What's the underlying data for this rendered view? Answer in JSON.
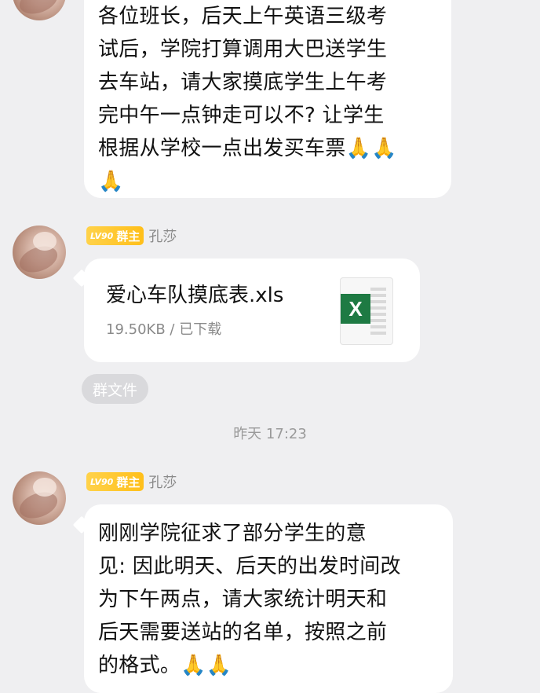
{
  "messages": [
    {
      "text": "各位班长，后天上午英语三级考\n试后，学院打算调用大巴送学生\n去车站，请大家摸底学生上午考\n完中午一点钟走可以不? 让学生\n根据从学校一点出发买车票🙏🙏\n🙏"
    },
    {
      "sender": {
        "level": "LV90",
        "role": "群主",
        "name": "孔莎"
      },
      "file": {
        "name": "爱心车队摸底表.xls",
        "meta": "19.50KB / 已下载",
        "icon": "excel-file-icon"
      },
      "tag": "群文件"
    },
    {
      "sender": {
        "level": "LV90",
        "role": "群主",
        "name": "孔莎"
      },
      "text": "刚刚学院征求了部分学生的意\n见: 因此明天、后天的出发时间改\n为下午两点，请大家统计明天和\n后天需要送站的名单，按照之前\n的格式。🙏🙏"
    }
  ],
  "time_separator": "昨天 17:23",
  "colors": {
    "background": "#efeff1",
    "bubble": "#ffffff",
    "badge": "#ffc21f",
    "excel": "#1e7a43"
  }
}
